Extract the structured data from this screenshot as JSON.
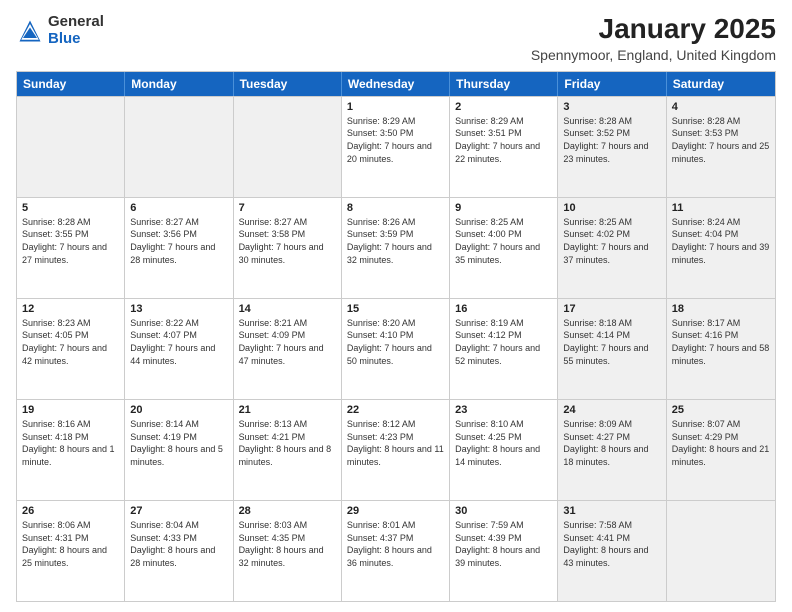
{
  "header": {
    "logo_general": "General",
    "logo_blue": "Blue",
    "month_title": "January 2025",
    "location": "Spennymoor, England, United Kingdom"
  },
  "weekdays": [
    "Sunday",
    "Monday",
    "Tuesday",
    "Wednesday",
    "Thursday",
    "Friday",
    "Saturday"
  ],
  "weeks": [
    [
      {
        "day": "",
        "sunrise": "",
        "sunset": "",
        "daylight": "",
        "shaded": true
      },
      {
        "day": "",
        "sunrise": "",
        "sunset": "",
        "daylight": "",
        "shaded": true
      },
      {
        "day": "",
        "sunrise": "",
        "sunset": "",
        "daylight": "",
        "shaded": true
      },
      {
        "day": "1",
        "sunrise": "Sunrise: 8:29 AM",
        "sunset": "Sunset: 3:50 PM",
        "daylight": "Daylight: 7 hours and 20 minutes.",
        "shaded": false
      },
      {
        "day": "2",
        "sunrise": "Sunrise: 8:29 AM",
        "sunset": "Sunset: 3:51 PM",
        "daylight": "Daylight: 7 hours and 22 minutes.",
        "shaded": false
      },
      {
        "day": "3",
        "sunrise": "Sunrise: 8:28 AM",
        "sunset": "Sunset: 3:52 PM",
        "daylight": "Daylight: 7 hours and 23 minutes.",
        "shaded": true
      },
      {
        "day": "4",
        "sunrise": "Sunrise: 8:28 AM",
        "sunset": "Sunset: 3:53 PM",
        "daylight": "Daylight: 7 hours and 25 minutes.",
        "shaded": true
      }
    ],
    [
      {
        "day": "5",
        "sunrise": "Sunrise: 8:28 AM",
        "sunset": "Sunset: 3:55 PM",
        "daylight": "Daylight: 7 hours and 27 minutes.",
        "shaded": false
      },
      {
        "day": "6",
        "sunrise": "Sunrise: 8:27 AM",
        "sunset": "Sunset: 3:56 PM",
        "daylight": "Daylight: 7 hours and 28 minutes.",
        "shaded": false
      },
      {
        "day": "7",
        "sunrise": "Sunrise: 8:27 AM",
        "sunset": "Sunset: 3:58 PM",
        "daylight": "Daylight: 7 hours and 30 minutes.",
        "shaded": false
      },
      {
        "day": "8",
        "sunrise": "Sunrise: 8:26 AM",
        "sunset": "Sunset: 3:59 PM",
        "daylight": "Daylight: 7 hours and 32 minutes.",
        "shaded": false
      },
      {
        "day": "9",
        "sunrise": "Sunrise: 8:25 AM",
        "sunset": "Sunset: 4:00 PM",
        "daylight": "Daylight: 7 hours and 35 minutes.",
        "shaded": false
      },
      {
        "day": "10",
        "sunrise": "Sunrise: 8:25 AM",
        "sunset": "Sunset: 4:02 PM",
        "daylight": "Daylight: 7 hours and 37 minutes.",
        "shaded": true
      },
      {
        "day": "11",
        "sunrise": "Sunrise: 8:24 AM",
        "sunset": "Sunset: 4:04 PM",
        "daylight": "Daylight: 7 hours and 39 minutes.",
        "shaded": true
      }
    ],
    [
      {
        "day": "12",
        "sunrise": "Sunrise: 8:23 AM",
        "sunset": "Sunset: 4:05 PM",
        "daylight": "Daylight: 7 hours and 42 minutes.",
        "shaded": false
      },
      {
        "day": "13",
        "sunrise": "Sunrise: 8:22 AM",
        "sunset": "Sunset: 4:07 PM",
        "daylight": "Daylight: 7 hours and 44 minutes.",
        "shaded": false
      },
      {
        "day": "14",
        "sunrise": "Sunrise: 8:21 AM",
        "sunset": "Sunset: 4:09 PM",
        "daylight": "Daylight: 7 hours and 47 minutes.",
        "shaded": false
      },
      {
        "day": "15",
        "sunrise": "Sunrise: 8:20 AM",
        "sunset": "Sunset: 4:10 PM",
        "daylight": "Daylight: 7 hours and 50 minutes.",
        "shaded": false
      },
      {
        "day": "16",
        "sunrise": "Sunrise: 8:19 AM",
        "sunset": "Sunset: 4:12 PM",
        "daylight": "Daylight: 7 hours and 52 minutes.",
        "shaded": false
      },
      {
        "day": "17",
        "sunrise": "Sunrise: 8:18 AM",
        "sunset": "Sunset: 4:14 PM",
        "daylight": "Daylight: 7 hours and 55 minutes.",
        "shaded": true
      },
      {
        "day": "18",
        "sunrise": "Sunrise: 8:17 AM",
        "sunset": "Sunset: 4:16 PM",
        "daylight": "Daylight: 7 hours and 58 minutes.",
        "shaded": true
      }
    ],
    [
      {
        "day": "19",
        "sunrise": "Sunrise: 8:16 AM",
        "sunset": "Sunset: 4:18 PM",
        "daylight": "Daylight: 8 hours and 1 minute.",
        "shaded": false
      },
      {
        "day": "20",
        "sunrise": "Sunrise: 8:14 AM",
        "sunset": "Sunset: 4:19 PM",
        "daylight": "Daylight: 8 hours and 5 minutes.",
        "shaded": false
      },
      {
        "day": "21",
        "sunrise": "Sunrise: 8:13 AM",
        "sunset": "Sunset: 4:21 PM",
        "daylight": "Daylight: 8 hours and 8 minutes.",
        "shaded": false
      },
      {
        "day": "22",
        "sunrise": "Sunrise: 8:12 AM",
        "sunset": "Sunset: 4:23 PM",
        "daylight": "Daylight: 8 hours and 11 minutes.",
        "shaded": false
      },
      {
        "day": "23",
        "sunrise": "Sunrise: 8:10 AM",
        "sunset": "Sunset: 4:25 PM",
        "daylight": "Daylight: 8 hours and 14 minutes.",
        "shaded": false
      },
      {
        "day": "24",
        "sunrise": "Sunrise: 8:09 AM",
        "sunset": "Sunset: 4:27 PM",
        "daylight": "Daylight: 8 hours and 18 minutes.",
        "shaded": true
      },
      {
        "day": "25",
        "sunrise": "Sunrise: 8:07 AM",
        "sunset": "Sunset: 4:29 PM",
        "daylight": "Daylight: 8 hours and 21 minutes.",
        "shaded": true
      }
    ],
    [
      {
        "day": "26",
        "sunrise": "Sunrise: 8:06 AM",
        "sunset": "Sunset: 4:31 PM",
        "daylight": "Daylight: 8 hours and 25 minutes.",
        "shaded": false
      },
      {
        "day": "27",
        "sunrise": "Sunrise: 8:04 AM",
        "sunset": "Sunset: 4:33 PM",
        "daylight": "Daylight: 8 hours and 28 minutes.",
        "shaded": false
      },
      {
        "day": "28",
        "sunrise": "Sunrise: 8:03 AM",
        "sunset": "Sunset: 4:35 PM",
        "daylight": "Daylight: 8 hours and 32 minutes.",
        "shaded": false
      },
      {
        "day": "29",
        "sunrise": "Sunrise: 8:01 AM",
        "sunset": "Sunset: 4:37 PM",
        "daylight": "Daylight: 8 hours and 36 minutes.",
        "shaded": false
      },
      {
        "day": "30",
        "sunrise": "Sunrise: 7:59 AM",
        "sunset": "Sunset: 4:39 PM",
        "daylight": "Daylight: 8 hours and 39 minutes.",
        "shaded": false
      },
      {
        "day": "31",
        "sunrise": "Sunrise: 7:58 AM",
        "sunset": "Sunset: 4:41 PM",
        "daylight": "Daylight: 8 hours and 43 minutes.",
        "shaded": true
      },
      {
        "day": "",
        "sunrise": "",
        "sunset": "",
        "daylight": "",
        "shaded": true
      }
    ]
  ]
}
